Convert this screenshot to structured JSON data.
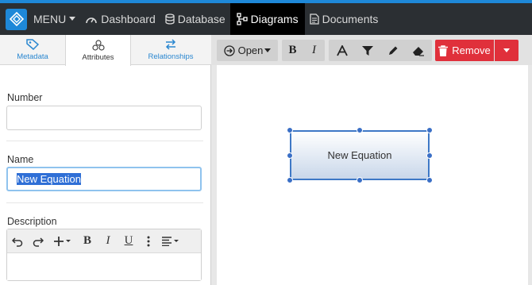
{
  "navbar": {
    "menu_label": "MENU",
    "items": [
      {
        "label": "Dashboard",
        "icon": "dashboard-icon"
      },
      {
        "label": "Database",
        "icon": "database-icon"
      },
      {
        "label": "Diagrams",
        "icon": "diagram-icon",
        "active": true
      },
      {
        "label": "Documents",
        "icon": "document-icon"
      }
    ]
  },
  "left_panel": {
    "tabs": [
      {
        "label": "Metadata",
        "icon": "tag-icon"
      },
      {
        "label": "Attributes",
        "icon": "attributes-icon",
        "active": true
      },
      {
        "label": "Relationships",
        "icon": "swap-arrows-icon"
      }
    ],
    "fields": {
      "number": {
        "label": "Number",
        "value": ""
      },
      "name": {
        "label": "Name",
        "value": "New Equation"
      },
      "description": {
        "label": "Description",
        "value": ""
      }
    },
    "editor_toolbar": [
      "undo-icon",
      "redo-icon",
      "insert-plus-icon",
      "bold-icon",
      "italic-icon",
      "underline-icon",
      "more-vertical-icon",
      "align-icon"
    ]
  },
  "diagram_toolbar": {
    "open_label": "Open",
    "remove_label": "Remove",
    "tools": [
      "bold-icon",
      "italic-icon",
      "text-icon",
      "filter-icon",
      "pencil-icon",
      "eraser-icon"
    ]
  },
  "canvas": {
    "shape_label": "New Equation"
  },
  "colors": {
    "navbar": "#2b2f33",
    "accent": "#1e88d8",
    "remove": "#e0303b",
    "selection": "#3e78c6"
  }
}
